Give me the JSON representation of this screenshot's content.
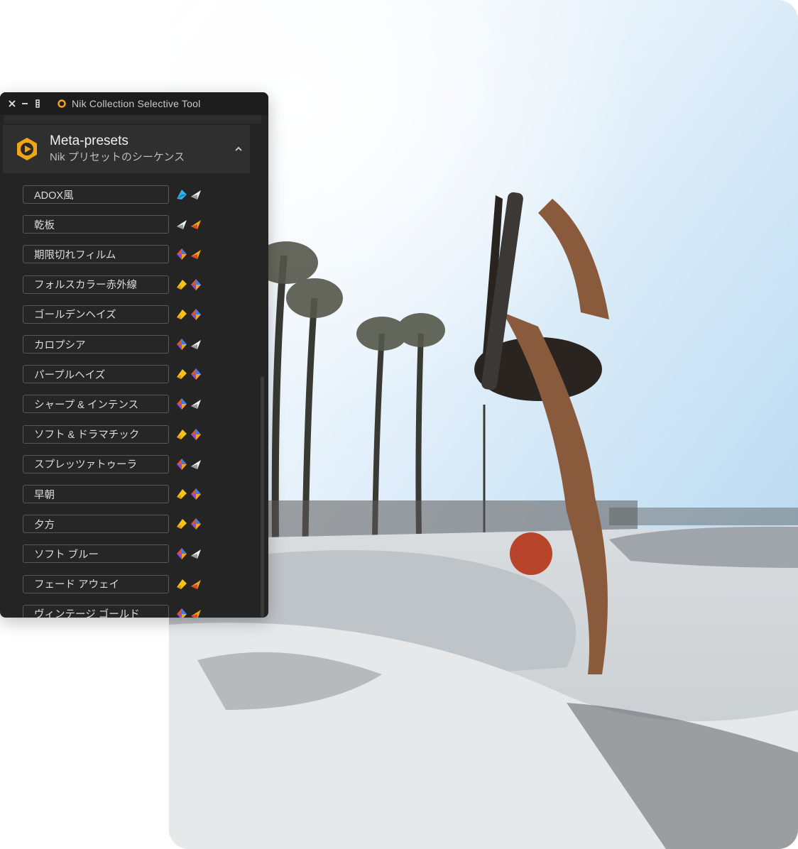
{
  "window": {
    "title": "Nik Collection Selective Tool",
    "controls": [
      "close-icon",
      "minimize-icon",
      "more-icon"
    ]
  },
  "section": {
    "title": "Meta-presets",
    "subtitle": "Nik プリセットのシーケンス",
    "icon": "meta-presets-icon",
    "expanded": true
  },
  "presets": [
    {
      "label": "ADOX風",
      "icons": [
        "blue",
        "white"
      ]
    },
    {
      "label": "乾板",
      "icons": [
        "white",
        "orange"
      ]
    },
    {
      "label": "期限切れフィルム",
      "icons": [
        "multi",
        "orange"
      ]
    },
    {
      "label": "フォルスカラー赤外線",
      "icons": [
        "yellow",
        "multi"
      ]
    },
    {
      "label": "ゴールデンヘイズ",
      "icons": [
        "yellow",
        "multi"
      ]
    },
    {
      "label": "カロプシア",
      "icons": [
        "multi",
        "white"
      ]
    },
    {
      "label": "パープルヘイズ",
      "icons": [
        "yellow",
        "multi"
      ]
    },
    {
      "label": "シャープ & インテンス",
      "icons": [
        "multi",
        "white"
      ]
    },
    {
      "label": "ソフト & ドラマチック",
      "icons": [
        "yellow",
        "multi"
      ]
    },
    {
      "label": "スプレッツァトゥーラ",
      "icons": [
        "multi",
        "white"
      ]
    },
    {
      "label": "早朝",
      "icons": [
        "yellow",
        "multi"
      ]
    },
    {
      "label": "夕方",
      "icons": [
        "yellow",
        "multi"
      ]
    },
    {
      "label": "ソフト ブルー",
      "icons": [
        "multi",
        "white"
      ]
    },
    {
      "label": "フェード アウェイ",
      "icons": [
        "yellow",
        "orange"
      ]
    },
    {
      "label": "ヴィンテージ ゴールド",
      "icons": [
        "multi",
        "orange"
      ]
    }
  ],
  "colors": {
    "panel_bg": "#242424",
    "accent_orange": "#f2a516",
    "plugin_blue": "#2cb3e8"
  }
}
